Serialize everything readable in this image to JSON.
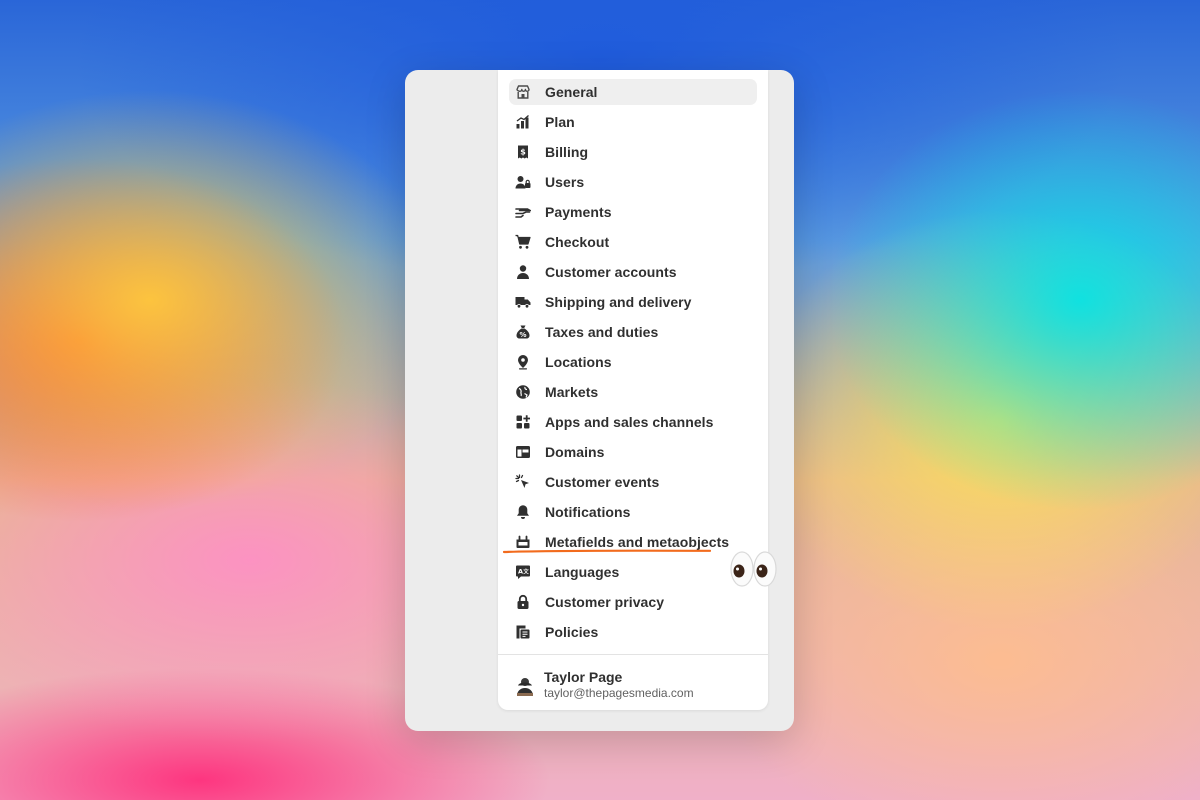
{
  "settings_menu": {
    "items": [
      {
        "label": "General",
        "icon": "store-icon",
        "active": true
      },
      {
        "label": "Plan",
        "icon": "plan-chart-icon"
      },
      {
        "label": "Billing",
        "icon": "receipt-dollar-icon"
      },
      {
        "label": "Users",
        "icon": "users-lock-icon"
      },
      {
        "label": "Payments",
        "icon": "hand-payment-icon"
      },
      {
        "label": "Checkout",
        "icon": "cart-icon"
      },
      {
        "label": "Customer accounts",
        "icon": "person-icon"
      },
      {
        "label": "Shipping and delivery",
        "icon": "truck-icon"
      },
      {
        "label": "Taxes and duties",
        "icon": "money-bag-icon"
      },
      {
        "label": "Locations",
        "icon": "location-pin-icon"
      },
      {
        "label": "Markets",
        "icon": "globe-icon"
      },
      {
        "label": "Apps and sales channels",
        "icon": "apps-grid-icon"
      },
      {
        "label": "Domains",
        "icon": "domain-window-icon"
      },
      {
        "label": "Customer events",
        "icon": "cursor-click-icon"
      },
      {
        "label": "Notifications",
        "icon": "bell-icon"
      },
      {
        "label": "Metafields and metaobjects",
        "icon": "metafields-icon",
        "highlighted": true
      },
      {
        "label": "Languages",
        "icon": "language-icon"
      },
      {
        "label": "Customer privacy",
        "icon": "lock-icon"
      },
      {
        "label": "Policies",
        "icon": "policy-document-icon"
      }
    ]
  },
  "user": {
    "name": "Taylor Page",
    "email": "taylor@thepagesmedia.com"
  },
  "annotation": {
    "underline_color": "#f26b1d",
    "emoji": "👀"
  },
  "colors": {
    "text": "#303030",
    "active_bg": "#efefef",
    "panel_bg": "#ffffff",
    "window_bg": "#ececec"
  }
}
